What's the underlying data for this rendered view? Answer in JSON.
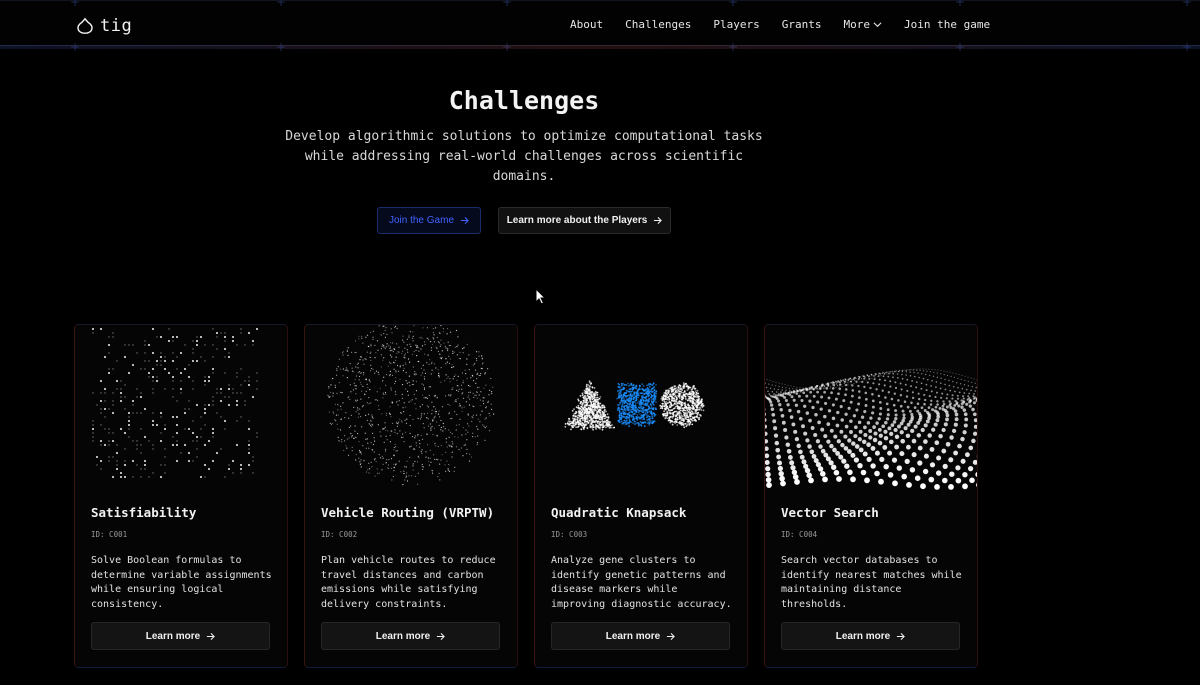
{
  "nav": {
    "logo_text": "tig",
    "links": [
      "About",
      "Challenges",
      "Players",
      "Grants",
      "More",
      "Join the game"
    ]
  },
  "hero": {
    "title": "Challenges",
    "subtitle_lines": [
      "Develop algorithmic solutions to optimize computational tasks",
      "while addressing real-world challenges across scientific",
      "domains."
    ],
    "primary_button": "Join the Game",
    "secondary_button": "Learn more about the Players"
  },
  "cards": [
    {
      "title": "Satisfiability",
      "id": "ID: C001",
      "description": "Solve Boolean formulas to determine variable assignments while ensuring logical consistency.",
      "button": "Learn more",
      "image": "scattered-dot-grid-icon"
    },
    {
      "title": "Vehicle Routing (VRPTW)",
      "id": "ID: C002",
      "description": "Plan vehicle routes to reduce travel distances and carbon emissions while satisfying delivery constraints.",
      "button": "Learn more",
      "image": "dot-sphere-icon"
    },
    {
      "title": "Quadratic Knapsack",
      "id": "ID: C003",
      "description": "Analyze gene clusters to identify genetic patterns and disease markers while improving diagnostic accuracy.",
      "button": "Learn more",
      "image": "triangle-square-circle-particles-icon"
    },
    {
      "title": "Vector Search",
      "id": "ID: C004",
      "description": "Search vector databases to identify nearest matches while maintaining distance thresholds.",
      "button": "Learn more",
      "image": "dot-wave-surface-icon"
    }
  ],
  "colors": {
    "background": "#000000",
    "accent_blue": "#3e63ff",
    "card_bg": "#050505",
    "particle_blue": "#1a8fff"
  }
}
